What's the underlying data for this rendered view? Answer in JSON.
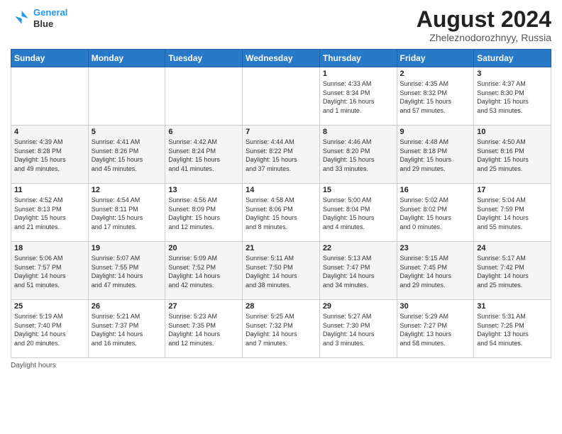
{
  "header": {
    "logo_line1": "General",
    "logo_line2": "Blue",
    "month_year": "August 2024",
    "location": "Zheleznodorozhnyy, Russia"
  },
  "days_of_week": [
    "Sunday",
    "Monday",
    "Tuesday",
    "Wednesday",
    "Thursday",
    "Friday",
    "Saturday"
  ],
  "weeks": [
    [
      {
        "day": "",
        "info": ""
      },
      {
        "day": "",
        "info": ""
      },
      {
        "day": "",
        "info": ""
      },
      {
        "day": "",
        "info": ""
      },
      {
        "day": "1",
        "info": "Sunrise: 4:33 AM\nSunset: 8:34 PM\nDaylight: 16 hours\nand 1 minute."
      },
      {
        "day": "2",
        "info": "Sunrise: 4:35 AM\nSunset: 8:32 PM\nDaylight: 15 hours\nand 57 minutes."
      },
      {
        "day": "3",
        "info": "Sunrise: 4:37 AM\nSunset: 8:30 PM\nDaylight: 15 hours\nand 53 minutes."
      }
    ],
    [
      {
        "day": "4",
        "info": "Sunrise: 4:39 AM\nSunset: 8:28 PM\nDaylight: 15 hours\nand 49 minutes."
      },
      {
        "day": "5",
        "info": "Sunrise: 4:41 AM\nSunset: 8:26 PM\nDaylight: 15 hours\nand 45 minutes."
      },
      {
        "day": "6",
        "info": "Sunrise: 4:42 AM\nSunset: 8:24 PM\nDaylight: 15 hours\nand 41 minutes."
      },
      {
        "day": "7",
        "info": "Sunrise: 4:44 AM\nSunset: 8:22 PM\nDaylight: 15 hours\nand 37 minutes."
      },
      {
        "day": "8",
        "info": "Sunrise: 4:46 AM\nSunset: 8:20 PM\nDaylight: 15 hours\nand 33 minutes."
      },
      {
        "day": "9",
        "info": "Sunrise: 4:48 AM\nSunset: 8:18 PM\nDaylight: 15 hours\nand 29 minutes."
      },
      {
        "day": "10",
        "info": "Sunrise: 4:50 AM\nSunset: 8:16 PM\nDaylight: 15 hours\nand 25 minutes."
      }
    ],
    [
      {
        "day": "11",
        "info": "Sunrise: 4:52 AM\nSunset: 8:13 PM\nDaylight: 15 hours\nand 21 minutes."
      },
      {
        "day": "12",
        "info": "Sunrise: 4:54 AM\nSunset: 8:11 PM\nDaylight: 15 hours\nand 17 minutes."
      },
      {
        "day": "13",
        "info": "Sunrise: 4:56 AM\nSunset: 8:09 PM\nDaylight: 15 hours\nand 12 minutes."
      },
      {
        "day": "14",
        "info": "Sunrise: 4:58 AM\nSunset: 8:06 PM\nDaylight: 15 hours\nand 8 minutes."
      },
      {
        "day": "15",
        "info": "Sunrise: 5:00 AM\nSunset: 8:04 PM\nDaylight: 15 hours\nand 4 minutes."
      },
      {
        "day": "16",
        "info": "Sunrise: 5:02 AM\nSunset: 8:02 PM\nDaylight: 15 hours\nand 0 minutes."
      },
      {
        "day": "17",
        "info": "Sunrise: 5:04 AM\nSunset: 7:59 PM\nDaylight: 14 hours\nand 55 minutes."
      }
    ],
    [
      {
        "day": "18",
        "info": "Sunrise: 5:06 AM\nSunset: 7:57 PM\nDaylight: 14 hours\nand 51 minutes."
      },
      {
        "day": "19",
        "info": "Sunrise: 5:07 AM\nSunset: 7:55 PM\nDaylight: 14 hours\nand 47 minutes."
      },
      {
        "day": "20",
        "info": "Sunrise: 5:09 AM\nSunset: 7:52 PM\nDaylight: 14 hours\nand 42 minutes."
      },
      {
        "day": "21",
        "info": "Sunrise: 5:11 AM\nSunset: 7:50 PM\nDaylight: 14 hours\nand 38 minutes."
      },
      {
        "day": "22",
        "info": "Sunrise: 5:13 AM\nSunset: 7:47 PM\nDaylight: 14 hours\nand 34 minutes."
      },
      {
        "day": "23",
        "info": "Sunrise: 5:15 AM\nSunset: 7:45 PM\nDaylight: 14 hours\nand 29 minutes."
      },
      {
        "day": "24",
        "info": "Sunrise: 5:17 AM\nSunset: 7:42 PM\nDaylight: 14 hours\nand 25 minutes."
      }
    ],
    [
      {
        "day": "25",
        "info": "Sunrise: 5:19 AM\nSunset: 7:40 PM\nDaylight: 14 hours\nand 20 minutes."
      },
      {
        "day": "26",
        "info": "Sunrise: 5:21 AM\nSunset: 7:37 PM\nDaylight: 14 hours\nand 16 minutes."
      },
      {
        "day": "27",
        "info": "Sunrise: 5:23 AM\nSunset: 7:35 PM\nDaylight: 14 hours\nand 12 minutes."
      },
      {
        "day": "28",
        "info": "Sunrise: 5:25 AM\nSunset: 7:32 PM\nDaylight: 14 hours\nand 7 minutes."
      },
      {
        "day": "29",
        "info": "Sunrise: 5:27 AM\nSunset: 7:30 PM\nDaylight: 14 hours\nand 3 minutes."
      },
      {
        "day": "30",
        "info": "Sunrise: 5:29 AM\nSunset: 7:27 PM\nDaylight: 13 hours\nand 58 minutes."
      },
      {
        "day": "31",
        "info": "Sunrise: 5:31 AM\nSunset: 7:25 PM\nDaylight: 13 hours\nand 54 minutes."
      }
    ]
  ],
  "footer": {
    "text": "Daylight hours"
  }
}
